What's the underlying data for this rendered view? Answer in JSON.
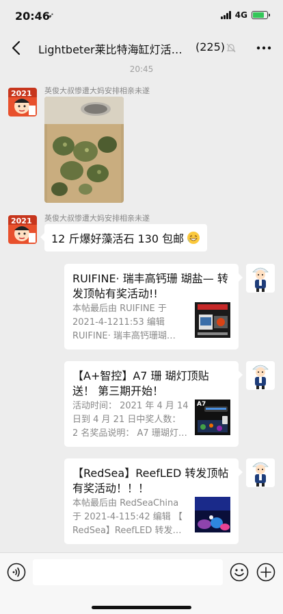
{
  "status": {
    "time": "20:46",
    "network": "4G"
  },
  "nav": {
    "title": "Lightbeter莱比特海缸灯活…",
    "count": "(225)"
  },
  "timestamp": "20:45",
  "messages": [
    {
      "sender": "英俊大叔惨遭大妈安排相亲未遂",
      "type": "image"
    },
    {
      "sender": "英俊大叔惨遭大妈安排相亲未遂",
      "type": "text",
      "text": "12 斤爆好藻活石 130 包邮"
    }
  ],
  "cards": [
    {
      "title": "RUIFINE· 瑞丰高钙珊 瑚盐— 转发顶帖有奖活动!!",
      "desc": "本帖最后由 RUIFINE 于 2021-4-1211:53 编辑 RUIFINE· 瑞丰高钙珊瑚…"
    },
    {
      "title": "【A+智控】A7 珊 瑚灯顶贴送！ 第三期开始！",
      "desc": "活动时间： 2021 年 4 月 14 日到 4 月 21 日中奖人数： 2 名奖品说明： A7 珊瑚灯…",
      "thumb_label": "A7"
    },
    {
      "title": "【RedSea】ReefLED 转发顶帖有奖活动！！！",
      "desc": "本帖最后由 RedSeaChina 于 2021-4-115:42 编辑 【 RedSea】ReefLED 转发…"
    }
  ],
  "colors": {
    "background": "#ededed",
    "bubble": "#ffffff",
    "muted_text": "#888888",
    "battery": "#34c759"
  },
  "input": {
    "placeholder": ""
  }
}
